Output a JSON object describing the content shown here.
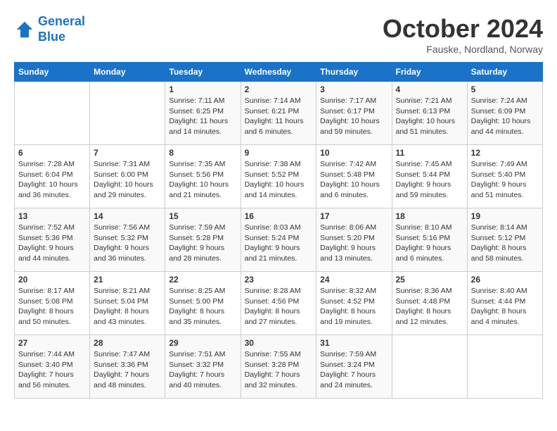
{
  "header": {
    "logo_line1": "General",
    "logo_line2": "Blue",
    "month": "October 2024",
    "location": "Fauske, Nordland, Norway"
  },
  "days_of_week": [
    "Sunday",
    "Monday",
    "Tuesday",
    "Wednesday",
    "Thursday",
    "Friday",
    "Saturday"
  ],
  "weeks": [
    [
      {
        "day": "",
        "info": ""
      },
      {
        "day": "",
        "info": ""
      },
      {
        "day": "1",
        "info": "Sunrise: 7:11 AM\nSunset: 6:25 PM\nDaylight: 11 hours\nand 14 minutes."
      },
      {
        "day": "2",
        "info": "Sunrise: 7:14 AM\nSunset: 6:21 PM\nDaylight: 11 hours\nand 6 minutes."
      },
      {
        "day": "3",
        "info": "Sunrise: 7:17 AM\nSunset: 6:17 PM\nDaylight: 10 hours\nand 59 minutes."
      },
      {
        "day": "4",
        "info": "Sunrise: 7:21 AM\nSunset: 6:13 PM\nDaylight: 10 hours\nand 51 minutes."
      },
      {
        "day": "5",
        "info": "Sunrise: 7:24 AM\nSunset: 6:09 PM\nDaylight: 10 hours\nand 44 minutes."
      }
    ],
    [
      {
        "day": "6",
        "info": "Sunrise: 7:28 AM\nSunset: 6:04 PM\nDaylight: 10 hours\nand 36 minutes."
      },
      {
        "day": "7",
        "info": "Sunrise: 7:31 AM\nSunset: 6:00 PM\nDaylight: 10 hours\nand 29 minutes."
      },
      {
        "day": "8",
        "info": "Sunrise: 7:35 AM\nSunset: 5:56 PM\nDaylight: 10 hours\nand 21 minutes."
      },
      {
        "day": "9",
        "info": "Sunrise: 7:38 AM\nSunset: 5:52 PM\nDaylight: 10 hours\nand 14 minutes."
      },
      {
        "day": "10",
        "info": "Sunrise: 7:42 AM\nSunset: 5:48 PM\nDaylight: 10 hours\nand 6 minutes."
      },
      {
        "day": "11",
        "info": "Sunrise: 7:45 AM\nSunset: 5:44 PM\nDaylight: 9 hours\nand 59 minutes."
      },
      {
        "day": "12",
        "info": "Sunrise: 7:49 AM\nSunset: 5:40 PM\nDaylight: 9 hours\nand 51 minutes."
      }
    ],
    [
      {
        "day": "13",
        "info": "Sunrise: 7:52 AM\nSunset: 5:36 PM\nDaylight: 9 hours\nand 44 minutes."
      },
      {
        "day": "14",
        "info": "Sunrise: 7:56 AM\nSunset: 5:32 PM\nDaylight: 9 hours\nand 36 minutes."
      },
      {
        "day": "15",
        "info": "Sunrise: 7:59 AM\nSunset: 5:28 PM\nDaylight: 9 hours\nand 28 minutes."
      },
      {
        "day": "16",
        "info": "Sunrise: 8:03 AM\nSunset: 5:24 PM\nDaylight: 9 hours\nand 21 minutes."
      },
      {
        "day": "17",
        "info": "Sunrise: 8:06 AM\nSunset: 5:20 PM\nDaylight: 9 hours\nand 13 minutes."
      },
      {
        "day": "18",
        "info": "Sunrise: 8:10 AM\nSunset: 5:16 PM\nDaylight: 9 hours\nand 6 minutes."
      },
      {
        "day": "19",
        "info": "Sunrise: 8:14 AM\nSunset: 5:12 PM\nDaylight: 8 hours\nand 58 minutes."
      }
    ],
    [
      {
        "day": "20",
        "info": "Sunrise: 8:17 AM\nSunset: 5:08 PM\nDaylight: 8 hours\nand 50 minutes."
      },
      {
        "day": "21",
        "info": "Sunrise: 8:21 AM\nSunset: 5:04 PM\nDaylight: 8 hours\nand 43 minutes."
      },
      {
        "day": "22",
        "info": "Sunrise: 8:25 AM\nSunset: 5:00 PM\nDaylight: 8 hours\nand 35 minutes."
      },
      {
        "day": "23",
        "info": "Sunrise: 8:28 AM\nSunset: 4:56 PM\nDaylight: 8 hours\nand 27 minutes."
      },
      {
        "day": "24",
        "info": "Sunrise: 8:32 AM\nSunset: 4:52 PM\nDaylight: 8 hours\nand 19 minutes."
      },
      {
        "day": "25",
        "info": "Sunrise: 8:36 AM\nSunset: 4:48 PM\nDaylight: 8 hours\nand 12 minutes."
      },
      {
        "day": "26",
        "info": "Sunrise: 8:40 AM\nSunset: 4:44 PM\nDaylight: 8 hours\nand 4 minutes."
      }
    ],
    [
      {
        "day": "27",
        "info": "Sunrise: 7:44 AM\nSunset: 3:40 PM\nDaylight: 7 hours\nand 56 minutes."
      },
      {
        "day": "28",
        "info": "Sunrise: 7:47 AM\nSunset: 3:36 PM\nDaylight: 7 hours\nand 48 minutes."
      },
      {
        "day": "29",
        "info": "Sunrise: 7:51 AM\nSunset: 3:32 PM\nDaylight: 7 hours\nand 40 minutes."
      },
      {
        "day": "30",
        "info": "Sunrise: 7:55 AM\nSunset: 3:28 PM\nDaylight: 7 hours\nand 32 minutes."
      },
      {
        "day": "31",
        "info": "Sunrise: 7:59 AM\nSunset: 3:24 PM\nDaylight: 7 hours\nand 24 minutes."
      },
      {
        "day": "",
        "info": ""
      },
      {
        "day": "",
        "info": ""
      }
    ]
  ]
}
